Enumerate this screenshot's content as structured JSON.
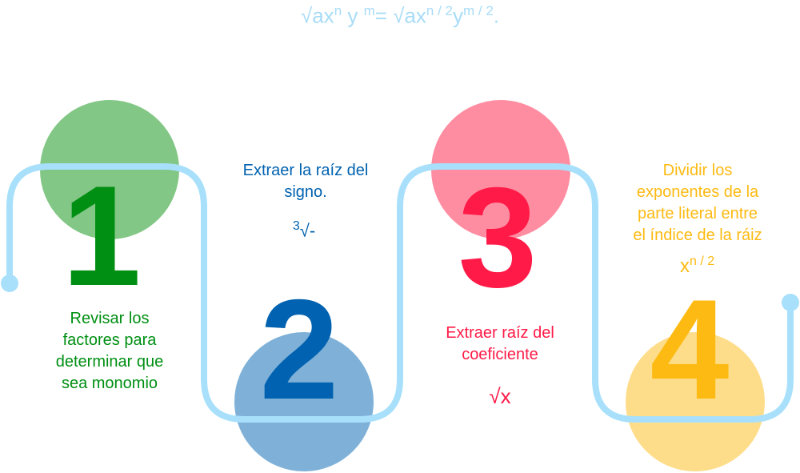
{
  "colors": {
    "path": "#a8e0fb",
    "step1": "#008f12",
    "step1_circle": "#82c785",
    "step2": "#0062b0",
    "step2_circle": "#7fb1d8",
    "step3": "#ff1a47",
    "step3_circle": "#ff8da2",
    "step4": "#fdba12",
    "step4_circle": "#fedd8a"
  },
  "formula": {
    "left_root": "√ax",
    "left_n": "n",
    "left_y": " y ",
    "left_m": "m",
    "equals": "= √ax",
    "right_exp_x": "n / 2",
    "right_y": "y",
    "right_exp_y": "m / 2",
    "end": "."
  },
  "steps": [
    {
      "number": "1",
      "lines": [
        "Revisar los",
        "factores para",
        "determinar que",
        "sea monomio"
      ]
    },
    {
      "number": "2",
      "lines": [
        "Extraer la raíz del",
        "signo."
      ],
      "symbol_index": "3",
      "symbol_root": "√-"
    },
    {
      "number": "3",
      "lines": [
        "Extraer raíz del",
        "coeficiente"
      ],
      "symbol": "√x"
    },
    {
      "number": "4",
      "lines": [
        "Dividir los",
        "exponentes de la",
        "parte literal entre",
        "el índice de la ráiz"
      ],
      "symbol_base": "x",
      "symbol_exp": "n / 2"
    }
  ]
}
